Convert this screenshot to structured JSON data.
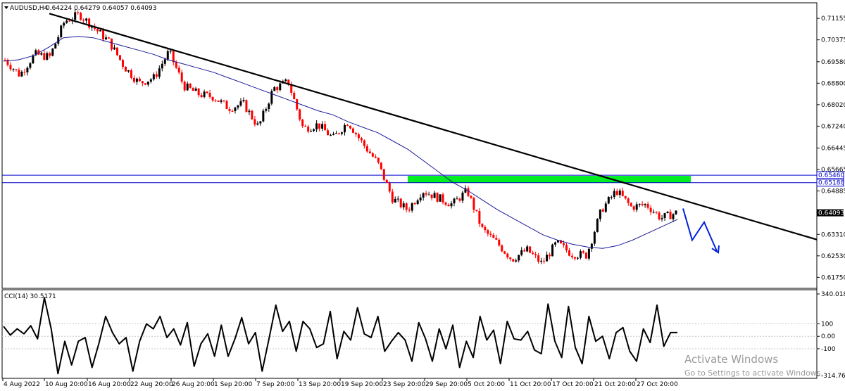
{
  "header": {
    "symbol": "AUDUSD,H4",
    "ohlc": "0.64224 0.64279 0.64057 0.64093"
  },
  "indicator": {
    "label": "CCI(14) 30.5171"
  },
  "watermark": {
    "title": "Activate Windows",
    "subtitle": "Go to Settings to activate Windows."
  },
  "colors": {
    "bull": "#000000",
    "bear": "#ff0000",
    "ma": "#1a1a99",
    "trendline": "#000000",
    "zone": "#00ee22",
    "levels": "#0000cc",
    "projection": "#0022dd",
    "cci": "#000000"
  },
  "chart_data": [
    {
      "type": "candlestick",
      "title": "AUDUSD,H4",
      "yticks": [
        "0.71155",
        "0.70375",
        "0.69580",
        "0.68800",
        "0.68020",
        "0.67240",
        "0.66445",
        "0.65665",
        "0.64885",
        "0.64093",
        "0.63310",
        "0.62530",
        "0.61750"
      ],
      "ylim": [
        0.6135,
        0.7172
      ],
      "xticks": [
        "4 Aug 2022",
        "10 Aug 20:00",
        "16 Aug 20:00",
        "22 Aug 20:00",
        "26 Aug 20:00",
        "1 Sep 20:00",
        "7 Sep 20:00",
        "13 Sep 20:00",
        "19 Sep 20:00",
        "23 Sep 20:00",
        "29 Sep 20:00",
        "5 Oct 20:00",
        "11 Oct 20:00",
        "17 Oct 20:00",
        "21 Oct 20:00",
        "27 Oct 20:00"
      ],
      "current_price": "0.64093",
      "levels": [
        {
          "label": "0.65460",
          "value": 0.6546
        },
        {
          "label": "0.65188",
          "value": 0.65188
        }
      ],
      "zone": {
        "from": "23 Sep 20:00",
        "to": "3 Nov",
        "low": 0.6518,
        "high": 0.6546
      },
      "trendline": {
        "start": {
          "x": "10 Aug 08:00",
          "y": 0.7133
        },
        "end": {
          "x": "4 Nov 08:00",
          "y": 0.6312
        }
      },
      "projection": [
        0.6425,
        0.631,
        0.6375,
        0.627
      ],
      "moving_average": [
        0.696,
        0.6965,
        0.698,
        0.701,
        0.7045,
        0.705,
        0.7045,
        0.703,
        0.7015,
        0.7,
        0.6985,
        0.6965,
        0.695,
        0.6935,
        0.692,
        0.69,
        0.688,
        0.686,
        0.684,
        0.682,
        0.68,
        0.678,
        0.6765,
        0.674,
        0.672,
        0.67,
        0.667,
        0.664,
        0.66,
        0.656,
        0.652,
        0.649,
        0.6455,
        0.642,
        0.639,
        0.636,
        0.633,
        0.631,
        0.6295,
        0.6285,
        0.628,
        0.629,
        0.631,
        0.6335,
        0.636,
        0.6385
      ],
      "close_path": [
        0.6965,
        0.691,
        0.6985,
        0.6975,
        0.7105,
        0.713,
        0.708,
        0.703,
        0.694,
        0.688,
        0.69,
        0.6995,
        0.687,
        0.684,
        0.683,
        0.679,
        0.6805,
        0.672,
        0.686,
        0.6885,
        0.6715,
        0.673,
        0.668,
        0.674,
        0.666,
        0.659,
        0.646,
        0.642,
        0.649,
        0.6465,
        0.644,
        0.649,
        0.635,
        0.63,
        0.624,
        0.6275,
        0.6225,
        0.63,
        0.626,
        0.6255,
        0.642,
        0.649,
        0.643,
        0.644,
        0.639,
        0.6409
      ]
    },
    {
      "type": "line",
      "title": "CCI(14) 30.5171",
      "yticks": [
        "340.0185",
        "100",
        "0.00",
        "-100",
        "-314.7695"
      ],
      "ylim": [
        -314.7695,
        340.0185
      ],
      "values": [
        80,
        10,
        60,
        20,
        85,
        -20,
        310,
        60,
        -300,
        -40,
        -230,
        -40,
        -10,
        -250,
        -60,
        160,
        30,
        -60,
        -10,
        -280,
        -40,
        100,
        60,
        160,
        -10,
        60,
        -70,
        110,
        -240,
        -60,
        20,
        -160,
        90,
        -160,
        -20,
        150,
        -60,
        30,
        -280,
        -20,
        250,
        40,
        120,
        -120,
        120,
        60,
        -90,
        -60,
        200,
        -180,
        40,
        -30,
        230,
        20,
        -10,
        160,
        -120,
        -40,
        30,
        -30,
        -200,
        110,
        -20,
        -200,
        60,
        -100,
        90,
        -250,
        -40,
        -170,
        160,
        -30,
        50,
        -220,
        120,
        -20,
        -30,
        40,
        -110,
        -140,
        260,
        -40,
        -170,
        240,
        -90,
        -220,
        160,
        -40,
        0,
        -180,
        30,
        70,
        -120,
        -200,
        60,
        -50,
        250,
        -80,
        30,
        30
      ]
    }
  ]
}
